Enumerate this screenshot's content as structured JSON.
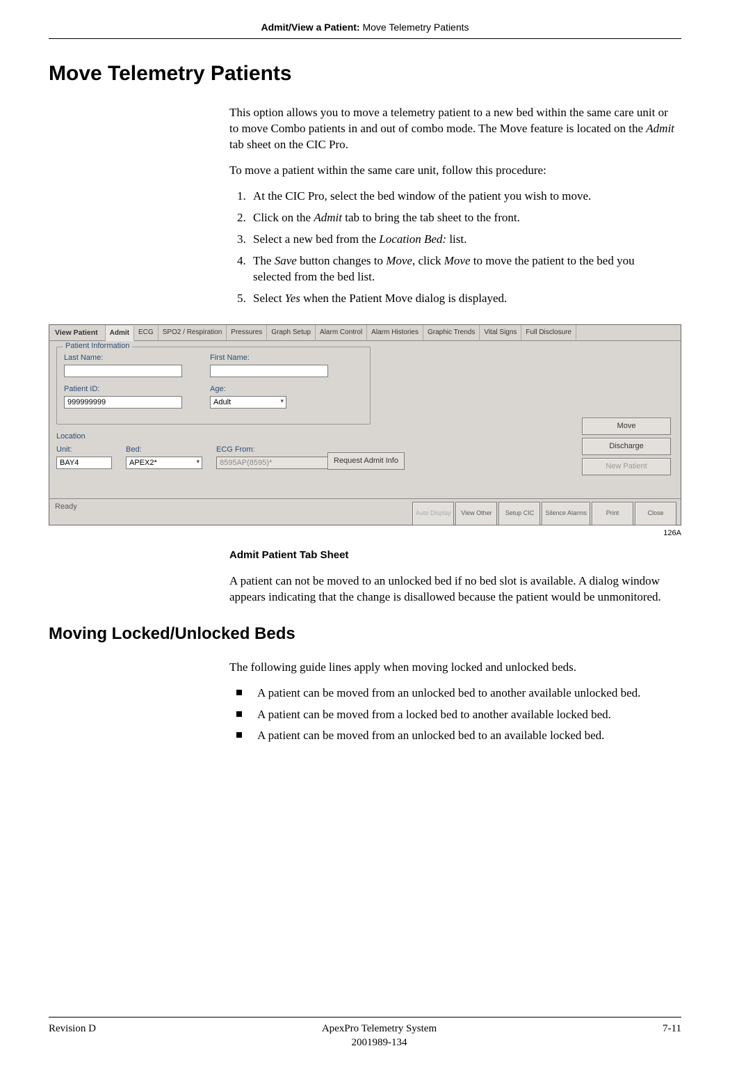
{
  "header": {
    "section_bold": "Admit/View a Patient:",
    "section_rest": " Move Telemetry Patients"
  },
  "h1": "Move Telemetry Patients",
  "intro_para": "This option allows you to move a telemetry patient to a new bed within the same care unit or to move Combo patients in and out of combo mode. The Move feature is located on the ",
  "intro_em1": "Admit",
  "intro_after_em1": " tab sheet on the CIC Pro.",
  "para2": "To move a patient within the same care unit, follow this procedure:",
  "steps": {
    "s1": "At the CIC Pro, select the bed window of the patient you wish to move.",
    "s2a": "Click on the ",
    "s2em": "Admit",
    "s2b": " tab to bring the tab sheet to the front.",
    "s3a": "Select a new bed from the ",
    "s3em": "Location Bed:",
    "s3b": " list.",
    "s4a": "The ",
    "s4em1": "Save",
    "s4b": " button changes to ",
    "s4em2": "Move",
    "s4c": ", click ",
    "s4em3": "Move",
    "s4d": " to move the patient to the bed you selected from the bed list.",
    "s5a": "Select ",
    "s5em": "Yes",
    "s5b": " when the Patient Move dialog is displayed."
  },
  "screenshot": {
    "tabs": {
      "view_patient": "View Patient",
      "admit": "Admit",
      "ecg": "ECG",
      "spo2": "SPO2 / Respiration",
      "pressures": "Pressures",
      "graph_setup": "Graph Setup",
      "alarm_control": "Alarm Control",
      "alarm_histories": "Alarm Histories",
      "graphic_trends": "Graphic Trends",
      "vital_signs": "Vital Signs",
      "full_disclosure": "Full Disclosure"
    },
    "patient_info_title": "Patient Information",
    "labels": {
      "last_name": "Last Name:",
      "first_name": "First Name:",
      "patient_id": "Patient ID:",
      "age": "Age:",
      "location": "Location",
      "unit": "Unit:",
      "bed": "Bed:",
      "ecg_from": "ECG From:"
    },
    "values": {
      "last_name": "",
      "first_name": "",
      "patient_id": "999999999",
      "age": "Adult",
      "unit": "BAY4",
      "bed": "APEX2*",
      "ecg_from": "8595AP(8595)*"
    },
    "buttons": {
      "move": "Move",
      "discharge": "Discharge",
      "new_patient": "New Patient",
      "request": "Request Admit Info"
    },
    "status": "Ready",
    "bottom": {
      "auto_display": "Auto Display",
      "view_other": "View Other",
      "setup_cic": "Setup CIC",
      "silence_alarms": "Silence Alarms",
      "print": "Print",
      "close": "Close"
    }
  },
  "figure_id": "126A",
  "caption": "Admit Patient Tab Sheet",
  "after_fig": "A patient can not be moved to an unlocked bed if no bed slot is available. A dialog window appears indicating that the change is disallowed because the patient would be unmonitored.",
  "h2": "Moving Locked/Unlocked Beds",
  "para3": "The following guide lines apply when moving locked and unlocked beds.",
  "bullets": {
    "b1": "A patient can be moved from an unlocked bed to another available unlocked bed.",
    "b2": "A patient can be moved from a locked bed to another available locked bed.",
    "b3": "A patient can be moved from an unlocked bed to an available locked bed."
  },
  "footer": {
    "left": "Revision D",
    "center1": "ApexPro Telemetry System",
    "center2": "2001989-134",
    "right": "7-11"
  }
}
